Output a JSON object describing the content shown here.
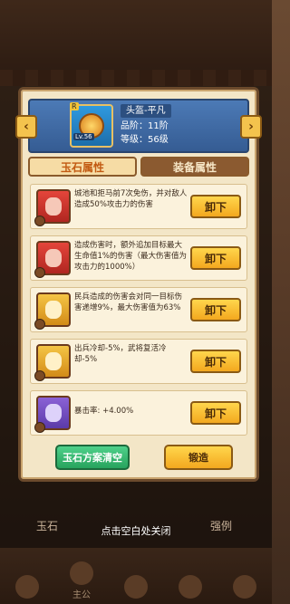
{
  "header": {
    "name": "头盔-平凡",
    "grade": "品阶：11阶",
    "level": "等级：56级",
    "item_level_badge": "Lv.56",
    "rarity_tag": "R"
  },
  "tabs": [
    {
      "label": "玉石属性"
    },
    {
      "label": "装备属性"
    }
  ],
  "gems": [
    {
      "text": "城池和拒马前7次免伤，并对敌人造成50%攻击力的伤害",
      "button": "卸下",
      "color": "red"
    },
    {
      "text": "造成伤害时，额外追加目标最大生命值1%的伤害（最大伤害值为攻击力的1000%）",
      "button": "卸下",
      "color": "red"
    },
    {
      "text": "民兵造成的伤害会对同一目标伤害递增9%，最大伤害值为63%",
      "button": "卸下",
      "color": "gold"
    },
    {
      "text": "出兵冷却-5%，武将复活冷却-5%",
      "button": "卸下",
      "color": "gold"
    },
    {
      "text": "暴击率: +4.00%",
      "button": "卸下",
      "color": "purple"
    }
  ],
  "actions": {
    "clear_label": "玉石方案清空",
    "forge_label": "锻造"
  },
  "background": {
    "tab_left": "玉石",
    "tab_right": "强例",
    "close_hint": "点击空白处关闭"
  },
  "nav": [
    "主公",
    "",
    "",
    "",
    ""
  ]
}
